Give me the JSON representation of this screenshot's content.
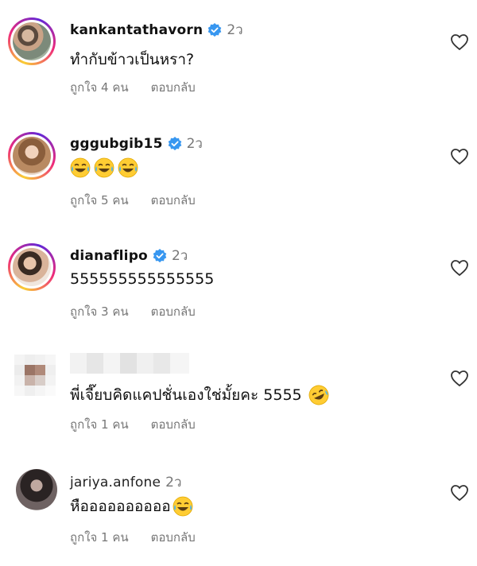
{
  "comments": [
    {
      "username": "kankantathavorn",
      "verified": true,
      "time": "2ว",
      "text": "ทำกับข้าวเป็นหรา?",
      "likes_label": "ถูกใจ 4 คน",
      "reply_label": "ตอบกลับ"
    },
    {
      "username": "gggubgib15",
      "verified": true,
      "time": "2ว",
      "text": "",
      "emoji_count": 3,
      "emoji_name": "face-with-tears-of-joy",
      "likes_label": "ถูกใจ 5 คน",
      "reply_label": "ตอบกลับ"
    },
    {
      "username": "dianaflipo",
      "verified": true,
      "time": "2ว",
      "text": "555555555555555",
      "likes_label": "ถูกใจ 3 คน",
      "reply_label": "ตอบกลับ"
    },
    {
      "username": "",
      "verified": false,
      "time": "",
      "text": "พี่เจี๊ยบคิดแคปชั่นเองใช่มั้ยคะ 5555",
      "emoji_name": "rolling-on-the-floor-laughing",
      "likes_label": "ถูกใจ 1 คน",
      "reply_label": "ตอบกลับ"
    },
    {
      "username": "jariya.anfone",
      "verified": false,
      "time": "2ว",
      "text": "หืออออออออออ",
      "emoji_name": "face-with-tears-of-joy",
      "likes_label": "ถูกใจ 1 คน",
      "reply_label": "ตอบกลับ"
    }
  ],
  "colors": {
    "verified_blue": "#3897f0",
    "meta_gray": "#777777",
    "story_ring": "#ee2a7b"
  },
  "icons": {
    "like": "heart-outline-icon",
    "verified": "verified-badge-icon"
  }
}
